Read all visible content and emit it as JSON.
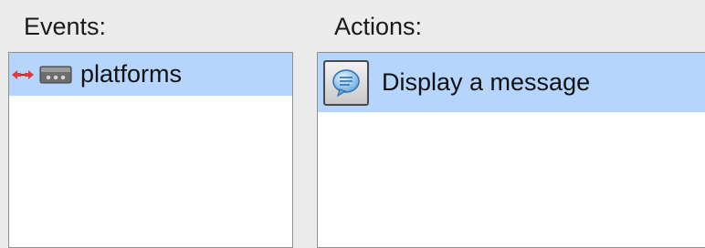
{
  "events": {
    "label": "Events:",
    "items": [
      {
        "label": "platforms",
        "icons": [
          "red-arrows-icon",
          "platform-object-icon"
        ],
        "selected": true
      }
    ]
  },
  "actions": {
    "label": "Actions:",
    "items": [
      {
        "label": "Display a message",
        "icon": "message-bubble-icon",
        "selected": true
      }
    ]
  },
  "colors": {
    "background": "#ececec",
    "selection": "#b5d5fc",
    "panel": "#ffffff",
    "border": "#8f8f8f"
  }
}
